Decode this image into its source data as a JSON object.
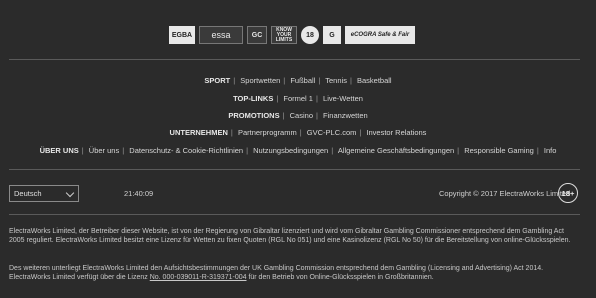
{
  "badges": [
    {
      "icon": "egba-logo",
      "text": "EGBA"
    },
    {
      "icon": "essa-logo",
      "text": "essa"
    },
    {
      "icon": "gambling-commission-logo",
      "text": "GC"
    },
    {
      "icon": "know-your-limits-logo",
      "text": "KNOW YOUR LIMITS"
    },
    {
      "icon": "age-restriction-logo",
      "text": "18"
    },
    {
      "icon": "gambleaware-logo",
      "text": "G"
    },
    {
      "icon": "ecogra-logo",
      "text": "eCOGRA Safe & Fair"
    }
  ],
  "nav": {
    "row1": {
      "head": "SPORT",
      "links": [
        "Sportwetten",
        "Fußball",
        "Tennis",
        "Basketball"
      ]
    },
    "row2": {
      "head": "TOP-LINKS",
      "links": [
        "Formel 1",
        "Live-Wetten"
      ]
    },
    "row3": {
      "head": "PROMOTIONS",
      "links": [
        "Casino",
        "Finanzwetten"
      ]
    },
    "row4": {
      "head": "UNTERNEHMEN",
      "links": [
        "Partnerprogramm",
        "GVC-PLC.com",
        "Investor Relations"
      ]
    },
    "row5": {
      "head": "ÜBER UNS",
      "links": [
        "Über uns",
        "Datenschutz- & Cookie-Richtlinien",
        "Nutzungsbedingungen",
        "Allgemeine Geschäftsbedingungen",
        "Responsible Gaming",
        "Info"
      ]
    }
  },
  "language_select": {
    "value": "Deutsch"
  },
  "clock": "21:40:09",
  "copyright": "Copyright © 2017 ElectraWorks Limited",
  "age_badge": "18+",
  "legal": {
    "p1": "ElectraWorks Limited, der Betreiber dieser Website, ist von der Regierung von Gibraltar lizenziert und wird vom Gibraltar Gambling Commissioner entsprechend dem Gambling Act 2005 reguliert. ElectraWorks Limited besitzt eine Lizenz für Wetten zu fixen Quoten (RGL No 051) und eine Kasinolizenz (RGL No 50) für die Bereitstellung von online-Glücksspielen.",
    "p2a": "Des weiteren unterliegt ElectraWorks Limited den Aufsichtsbestimmungen der UK Gambling Commission entsprechend dem Gambling (Licensing and Advertising) Act 2014. ElectraWorks Limited verfügt über die Lizenz ",
    "p2link": "No. 000-039011-R-319371-004",
    "p2b": " für den Betrieb von Online-Glücksspielen in Großbritannien."
  }
}
